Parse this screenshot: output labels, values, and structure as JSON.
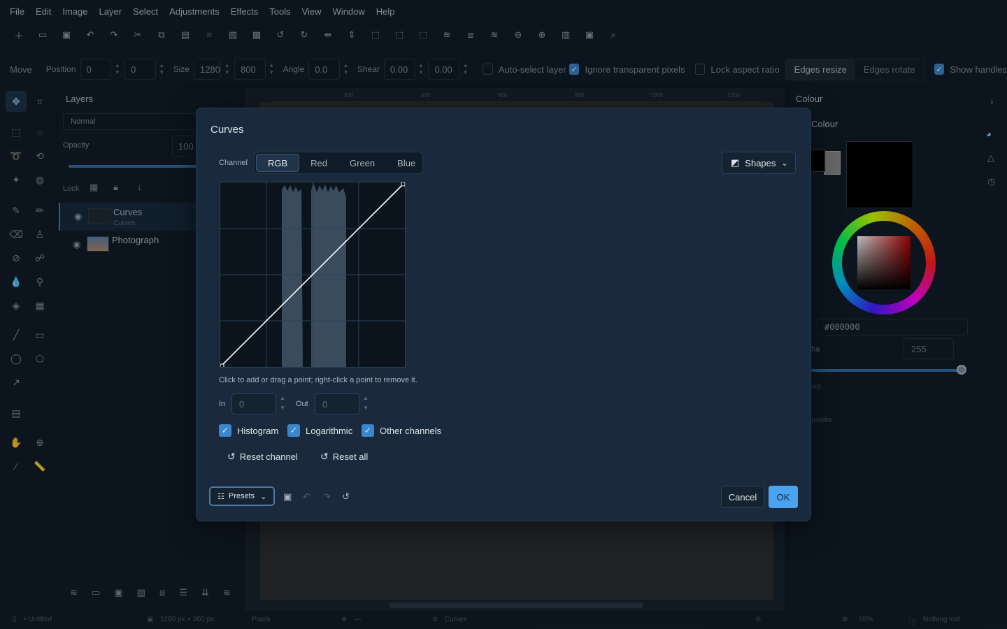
{
  "menu": [
    "File",
    "Edit",
    "Image",
    "Layer",
    "Select",
    "Adjustments",
    "Effects",
    "Tools",
    "View",
    "Window",
    "Help"
  ],
  "options": {
    "tool_name": "Move",
    "position_label": "Position",
    "pos_x": "0",
    "pos_y": "0",
    "size_label": "Size",
    "width": "1280",
    "height": "800",
    "angle_label": "Angle",
    "angle": "0.0",
    "shear_label": "Shear",
    "shear_x": "0.00",
    "shear_y": "0.00",
    "auto_select": "Auto-select layer",
    "ignore_transparent": "Ignore transparent pixels",
    "lock_aspect": "Lock aspect ratio",
    "edges_resize": "Edges resize",
    "edges_rotate": "Edges rotate",
    "show_handles": "Show handles"
  },
  "layers": {
    "title": "Layers",
    "blend_mode": "Normal",
    "opacity_label": "Opacity",
    "opacity_value": "100",
    "lock_label": "Lock",
    "items": [
      {
        "name": "Curves",
        "sub": "Curves"
      },
      {
        "name": "Photograph",
        "sub": ""
      }
    ]
  },
  "ruler": [
    "200",
    "400",
    "600",
    "800",
    "1000",
    "1200"
  ],
  "colour": {
    "title": "Colour",
    "sub": "Colour",
    "hex": "#000000",
    "alpha_label": "ha",
    "alpha_value": "255",
    "recent_label": "ent",
    "palette_label": "palette"
  },
  "status": {
    "doc": "• Untitled",
    "dims": "1280 px × 800 px",
    "unit": "Pixels",
    "cursor": "—",
    "layer": "Curves",
    "zoom": "55%",
    "history": "Nothing lost"
  },
  "dialog": {
    "title": "Curves",
    "channel_label": "Channel",
    "channels": [
      "RGB",
      "Red",
      "Green",
      "Blue"
    ],
    "active_channel": "RGB",
    "shapes": "Shapes",
    "hint": "Click to add or drag a point; right-click a point to remove it.",
    "in_label": "In",
    "in_placeholder": "0",
    "out_label": "Out",
    "out_placeholder": "0",
    "checkbox_histogram": "Histogram",
    "checkbox_logarithmic": "Logarithmic",
    "checkbox_other": "Other channels",
    "reset_channel": "Reset channel",
    "reset_all": "Reset all",
    "presets": "Presets",
    "cancel": "Cancel",
    "ok": "OK"
  },
  "colors": {
    "accent": "#4aa3f0",
    "dialog_bg": "#1a2a3c",
    "checkbox": "#3b87cc"
  }
}
